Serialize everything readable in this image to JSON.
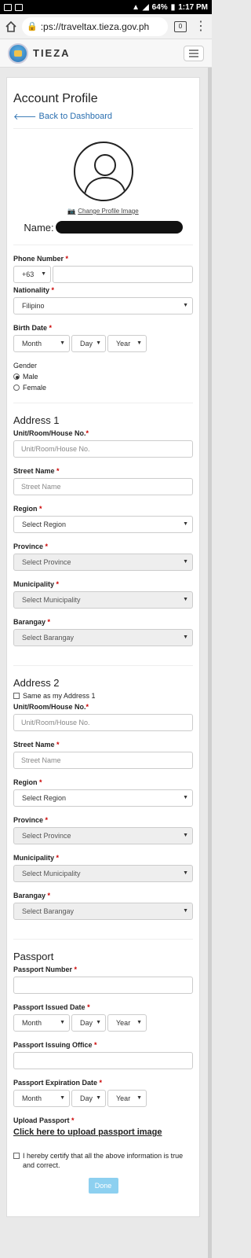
{
  "status_bar": {
    "battery": "64%",
    "time": "1:17 PM"
  },
  "browser": {
    "url": ":ps://traveltax.tieza.gov.ph",
    "tab_count": "0"
  },
  "app": {
    "brand": "TIEZA"
  },
  "profile": {
    "title": "Account Profile",
    "back_link": "Back to Dashboard",
    "change_image": "Change Profile Image",
    "name_label": "Name:"
  },
  "fields": {
    "phone_label": "Phone Number",
    "phone_code": "+63",
    "nationality_label": "Nationality",
    "nationality_value": "Filipino",
    "birth_label": "Birth Date",
    "month": "Month",
    "day": "Day",
    "year": "Year",
    "gender_label": "Gender",
    "male": "Male",
    "female": "Female"
  },
  "address1": {
    "title": "Address 1",
    "unit_label": "Unit/Room/House No.",
    "unit_placeholder": "Unit/Room/House No.",
    "street_label": "Street Name",
    "street_placeholder": "Street Name",
    "region_label": "Region",
    "region_value": "Select Region",
    "province_label": "Province",
    "province_value": "Select Province",
    "municipality_label": "Municipality",
    "municipality_value": "Select Municipality",
    "barangay_label": "Barangay",
    "barangay_value": "Select Barangay"
  },
  "address2": {
    "title": "Address 2",
    "same_as": "Same as my Address 1",
    "unit_label": "Unit/Room/House No.",
    "unit_placeholder": "Unit/Room/House No.",
    "street_label": "Street Name",
    "street_placeholder": "Street Name",
    "region_label": "Region",
    "region_value": "Select Region",
    "province_label": "Province",
    "province_value": "Select Province",
    "municipality_label": "Municipality",
    "municipality_value": "Select Municipality",
    "barangay_label": "Barangay",
    "barangay_value": "Select Barangay"
  },
  "passport": {
    "title": "Passport",
    "number_label": "Passport Number",
    "issued_label": "Passport Issued Date",
    "office_label": "Passport Issuing Office",
    "expiration_label": "Passport Expiration Date",
    "upload_label": "Upload Passport",
    "upload_link": "Click here to upload passport image",
    "month": "Month",
    "day": "Day",
    "year": "Year"
  },
  "certify": "I hereby certify that all the above information is true and correct.",
  "done": "Done"
}
